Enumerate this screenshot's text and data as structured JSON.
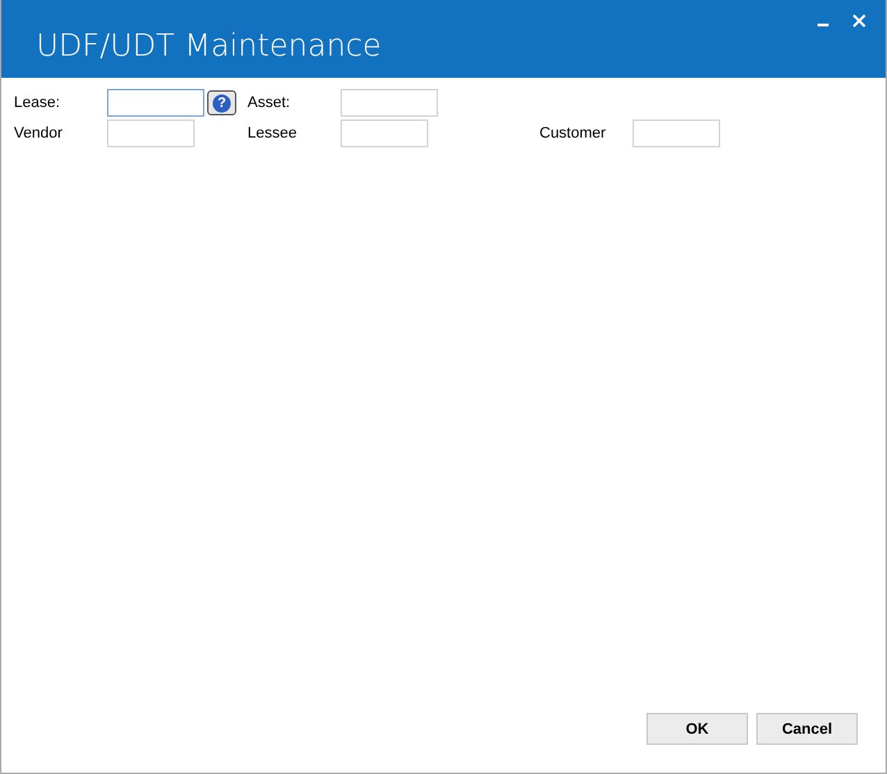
{
  "window": {
    "title": "UDF/UDT Maintenance"
  },
  "rows": [
    [
      {
        "label": "Lease:",
        "focused": true,
        "help": "?"
      },
      {
        "label": "Asset:",
        "focused": false
      }
    ],
    [
      {
        "label": "Vendor",
        "focused": false
      },
      {
        "label": "Lessee",
        "focused": false
      },
      {
        "label": "Customer",
        "focused": false
      }
    ]
  ],
  "buttons": [
    "OK",
    "Cancel"
  ]
}
